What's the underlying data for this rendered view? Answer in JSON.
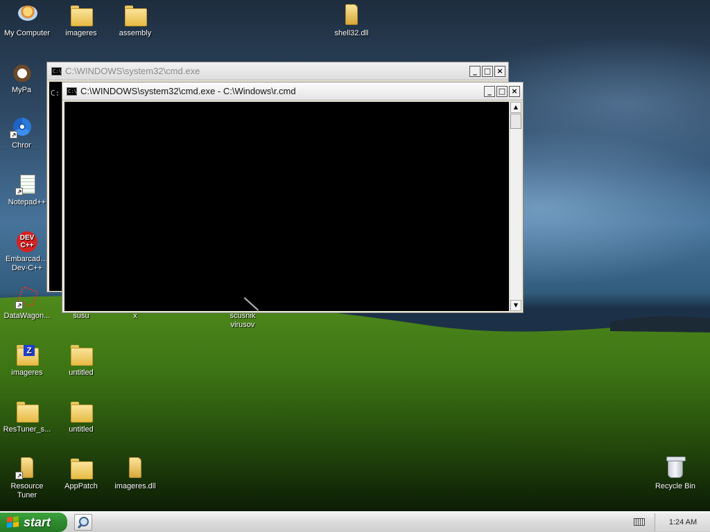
{
  "desktop": {
    "icons": [
      {
        "label": "My Computer",
        "icon": "my-computer-icon"
      },
      {
        "label": "imageres",
        "icon": "folder-icon"
      },
      {
        "label": "assembly",
        "icon": "folder-icon"
      },
      {
        "label": "shell32.dll",
        "icon": "dll-file-icon"
      },
      {
        "label": "MyPa",
        "icon": "mypaint-icon"
      },
      {
        "label": "Chror",
        "icon": "chrome-icon"
      },
      {
        "label": "Notepad++",
        "icon": "notepadpp-icon"
      },
      {
        "label": "Embarcadero Dev-C++",
        "icon": "devcpp-icon"
      },
      {
        "label": "DataWagon...",
        "icon": "datawagon-icon"
      },
      {
        "label": "susu",
        "icon": "folder-icon"
      },
      {
        "label": "x",
        "icon": "folder-icon"
      },
      {
        "label": "scusnik virusov",
        "icon": "file-icon"
      },
      {
        "label": "imageres",
        "icon": "zip-folder-icon"
      },
      {
        "label": "untitled",
        "icon": "folder-icon"
      },
      {
        "label": "ResTuner_s...",
        "icon": "folder-icon"
      },
      {
        "label": "untitled",
        "icon": "folder-icon"
      },
      {
        "label": "Resource Tuner",
        "icon": "dll-file-icon"
      },
      {
        "label": "AppPatch",
        "icon": "folder-icon"
      },
      {
        "label": "imageres.dll",
        "icon": "dll-file-icon"
      },
      {
        "label": "Recycle Bin",
        "icon": "recycle-bin-icon"
      }
    ]
  },
  "windows": {
    "back": {
      "title": "C:\\WINDOWS\\system32\\cmd.exe",
      "console_text": "C:",
      "buttons": [
        "_",
        "□",
        "×"
      ]
    },
    "front": {
      "title": "C:\\WINDOWS\\system32\\cmd.exe - C:\\Windows\\r.cmd",
      "console_text": "",
      "buttons": [
        "_",
        "□",
        "×"
      ]
    }
  },
  "taskbar": {
    "start_label": "start",
    "clock": "1:24 AM"
  },
  "colors": {
    "console_bg": "#000000",
    "taskbar_bg": "#dcdcdc",
    "start_green": "#2e8a2e"
  }
}
